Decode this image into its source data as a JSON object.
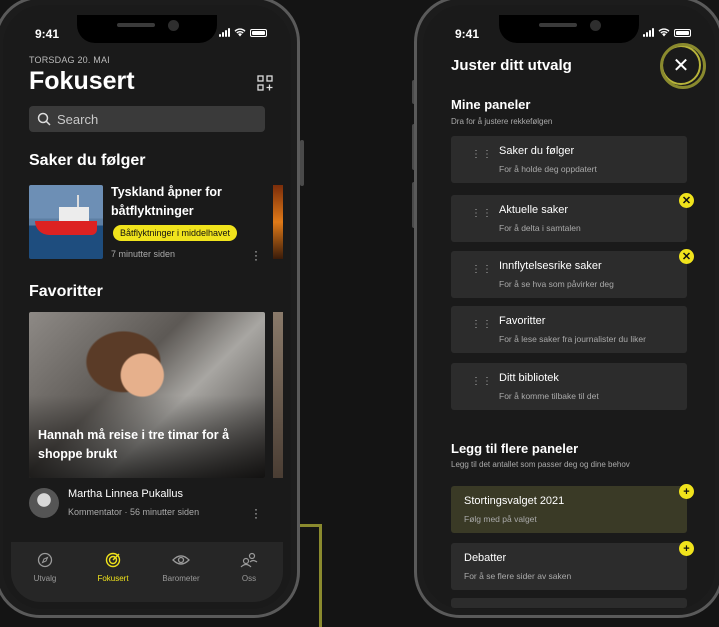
{
  "colors": {
    "accent": "#f0e31c",
    "guide": "#8a8a2e",
    "card": "#2c2c2c",
    "highlight": "#3a3a26"
  },
  "left_phone": {
    "status_time": "9:41",
    "date": "TORSDAG 20. MAI",
    "title": "Fokusert",
    "search_placeholder": "Search",
    "following": {
      "heading": "Saker du følger",
      "article_title": "Tyskland åpner for båtflyktninger",
      "tag": "Båtflyktninger i middelhavet",
      "time": "7 minutter siden"
    },
    "favorites": {
      "heading": "Favoritter",
      "caption": "Hannah må reise i tre timar for å shoppe brukt",
      "author": "Martha Linnea Pukallus",
      "role": "Kommentator",
      "time": "56 minutter siden"
    },
    "tabs": [
      {
        "label": "Utvalg",
        "icon": "compass-icon"
      },
      {
        "label": "Fokusert",
        "icon": "target-icon"
      },
      {
        "label": "Barometer",
        "icon": "eye-icon"
      },
      {
        "label": "Oss",
        "icon": "people-icon"
      }
    ]
  },
  "right_phone": {
    "status_time": "9:41",
    "title": "Juster ditt utvalg",
    "my_panels": {
      "heading": "Mine paneler",
      "sub": "Dra for å justere rekkefølgen",
      "items": [
        {
          "title": "Saker du følger",
          "sub": "For å holde deg oppdatert"
        },
        {
          "title": "Aktuelle saker",
          "sub": "For å delta i samtalen"
        },
        {
          "title": "Innflytelsesrike saker",
          "sub": "For å se hva som påvirker deg"
        },
        {
          "title": "Favoritter",
          "sub": "For å lese saker fra journalister du liker"
        },
        {
          "title": "Ditt bibliotek",
          "sub": "For å komme tilbake til det"
        }
      ]
    },
    "more_panels": {
      "heading": "Legg til flere paneler",
      "sub": "Legg til det antallet som passer deg og dine behov",
      "items": [
        {
          "title": "Stortingsvalget 2021",
          "sub": "Følg med på valget"
        },
        {
          "title": "Debatter",
          "sub": "For å se flere sider av saken"
        }
      ]
    }
  }
}
